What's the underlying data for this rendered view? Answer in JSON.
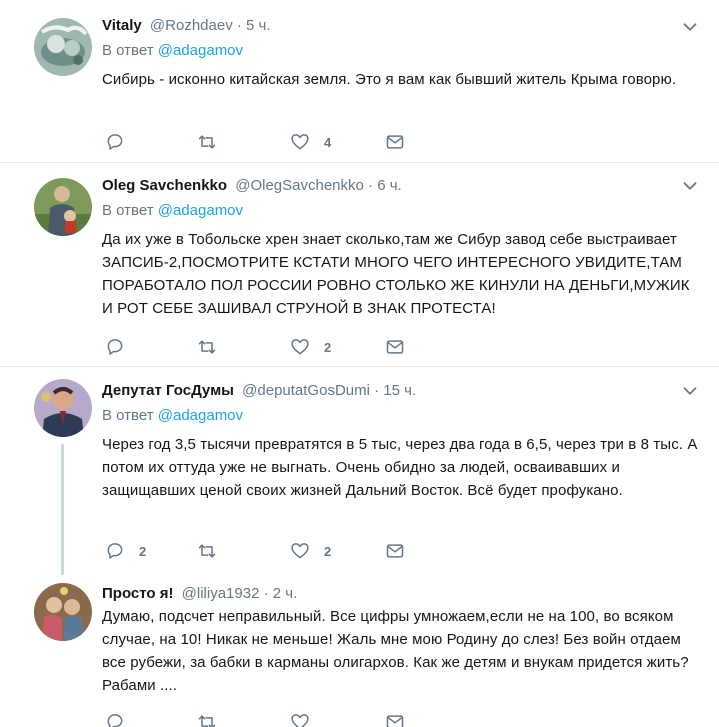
{
  "tweets": [
    {
      "name": "Vitaly",
      "handle": "@Rozhdaev",
      "sep": "·",
      "time": "5 ч.",
      "reply_prefix": "В ответ",
      "reply_to": "@adagamov",
      "text": "Сибирь - исконно китайская земля. Это я вам как бывший житель Крыма говорю.",
      "reply_count": "",
      "retweet_count": "",
      "like_count": "4"
    },
    {
      "name": "Oleg Savchenkko",
      "handle": "@OlegSavchenkko",
      "sep": "·",
      "time": "6 ч.",
      "reply_prefix": "В ответ",
      "reply_to": "@adagamov",
      "text": "Да их уже в Тобольске хрен знает сколько,там же Сибур завод себе выстраивает ЗАПСИБ-2,ПОСМОТРИТЕ КСТАТИ МНОГО ЧЕГО ИНТЕРЕСНОГО УВИДИТЕ,ТАМ ПОРАБОТАЛО ПОЛ РОССИИ РОВНО СТОЛЬКО ЖЕ КИНУЛИ НА ДЕНЬГИ,МУЖИК И РОТ СЕБЕ ЗАШИВАЛ СТРУНОЙ В ЗНАК ПРОТЕСТА!",
      "reply_count": "",
      "retweet_count": "",
      "like_count": "2"
    },
    {
      "name": "Депутат ГосДумы",
      "handle": "@deputatGosDumi",
      "sep": "·",
      "time": "15 ч.",
      "reply_prefix": "В ответ",
      "reply_to": "@adagamov",
      "text": "Через год 3,5 тысячи превратятся в 5 тыс, через два года в 6,5, через три в 8 тыс. А потом их оттуда уже не выгнать. Очень обидно за людей, осваивавших и защищавших ценой своих жизней Дальний Восток. Всё будет профукано.",
      "reply_count": "2",
      "retweet_count": "",
      "like_count": "2"
    },
    {
      "name": "Просто я!",
      "handle": "@liliya1932",
      "sep": "·",
      "time": "2 ч.",
      "reply_prefix": "",
      "reply_to": "",
      "text": "Думаю, подсчет неправильный. Все цифры умножаем,если не на 100, во всяком случае, на 10! Никак не меньше! Жаль мне мою Родину до слез! Без войн отдаем все рубежи, за бабки в карманы олигархов. Как же детям и внукам придется жить? Рабами ....",
      "reply_count": "",
      "retweet_count": "",
      "like_count": ""
    }
  ],
  "icons": {
    "reply": "reply-icon",
    "retweet": "retweet-icon",
    "like": "like-icon",
    "dm": "direct-message-icon",
    "caret": "chevron-down-icon"
  },
  "colors": {
    "link": "#1da1f2",
    "secondary": "#657786",
    "text": "#14171a",
    "divider": "#e6ecf0"
  }
}
